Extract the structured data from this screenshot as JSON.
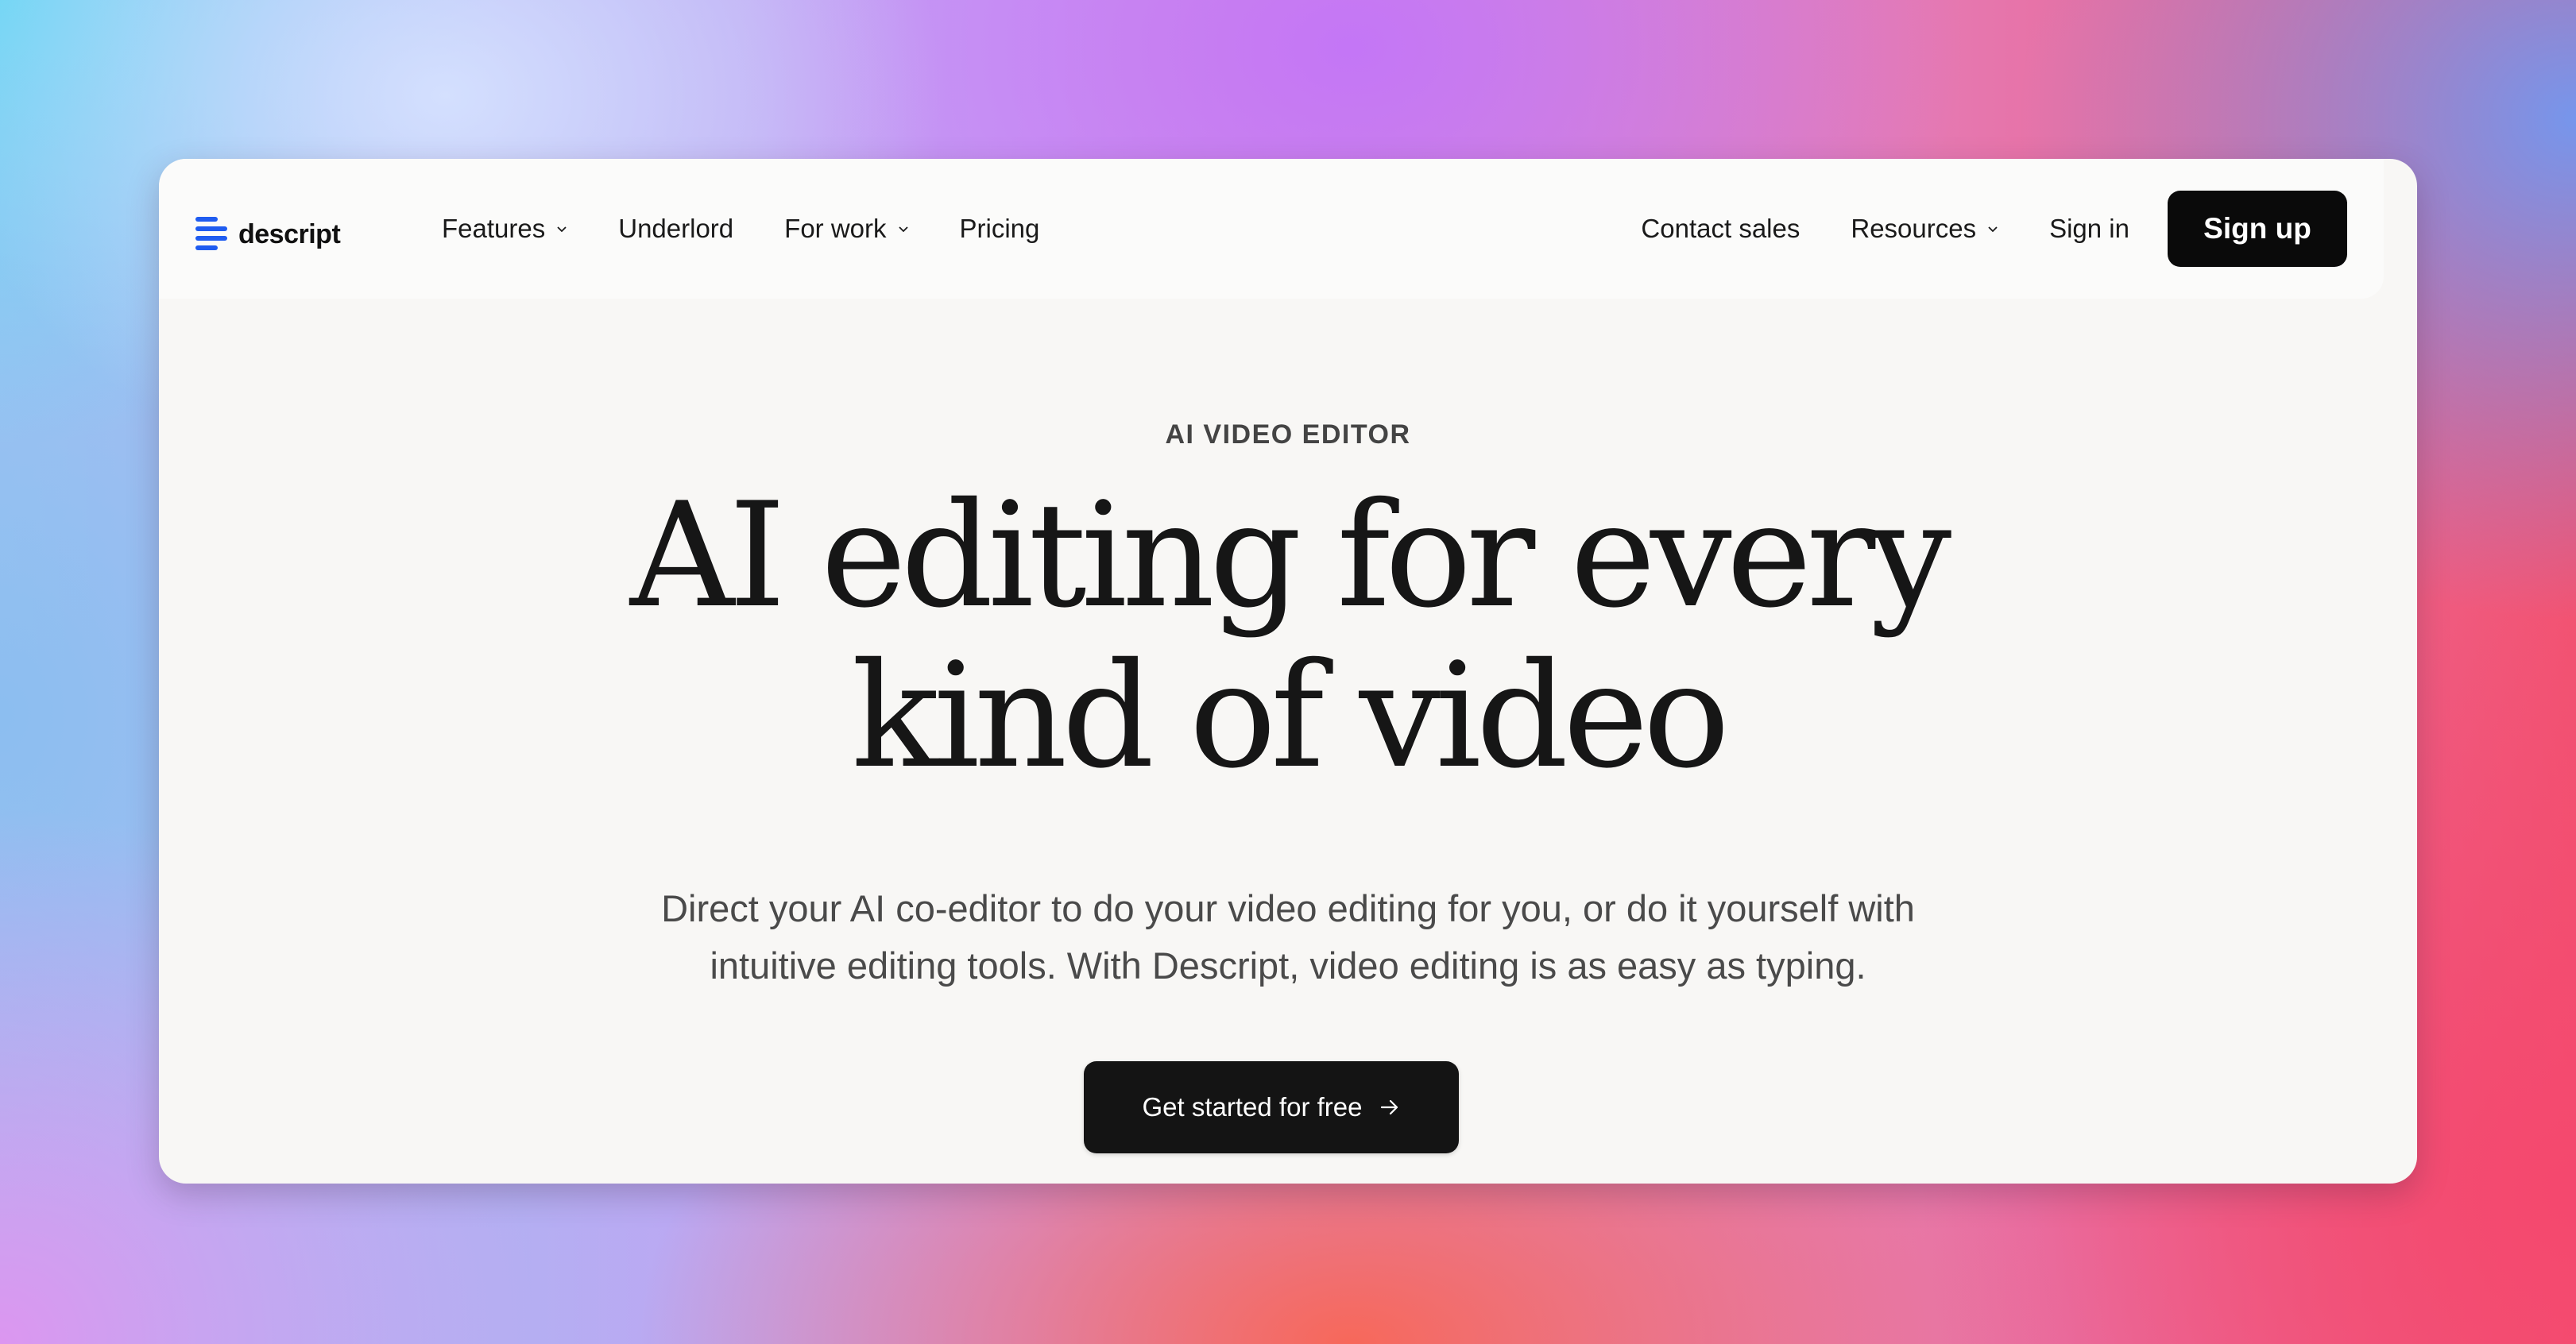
{
  "brand": {
    "name": "descript",
    "accent": "#1f5cf0"
  },
  "nav": {
    "left_items": [
      {
        "label": "Features",
        "dropdown": true
      },
      {
        "label": "Underlord",
        "dropdown": false
      },
      {
        "label": "For work",
        "dropdown": true
      },
      {
        "label": "Pricing",
        "dropdown": false
      }
    ],
    "right_items": [
      {
        "label": "Contact sales",
        "dropdown": false
      },
      {
        "label": "Resources",
        "dropdown": true
      },
      {
        "label": "Sign in",
        "dropdown": false
      }
    ],
    "signup_label": "Sign up",
    "chevron_icon": "chevron-down-icon"
  },
  "hero": {
    "eyebrow": "AI VIDEO EDITOR",
    "headline_line1": "AI editing for every",
    "headline_line2": "kind of video",
    "subtext_line1": "Direct your AI co-editor to do your video editing for you, or do it yourself with",
    "subtext_line2": "intuitive editing tools. With Descript, video editing is as easy as typing.",
    "cta_label": "Get started for free",
    "cta_icon": "arrow-right-icon"
  },
  "colors": {
    "card_background": "#f8f7f5",
    "button_dark": "#0a0a0a",
    "text_dark": "#161616"
  }
}
